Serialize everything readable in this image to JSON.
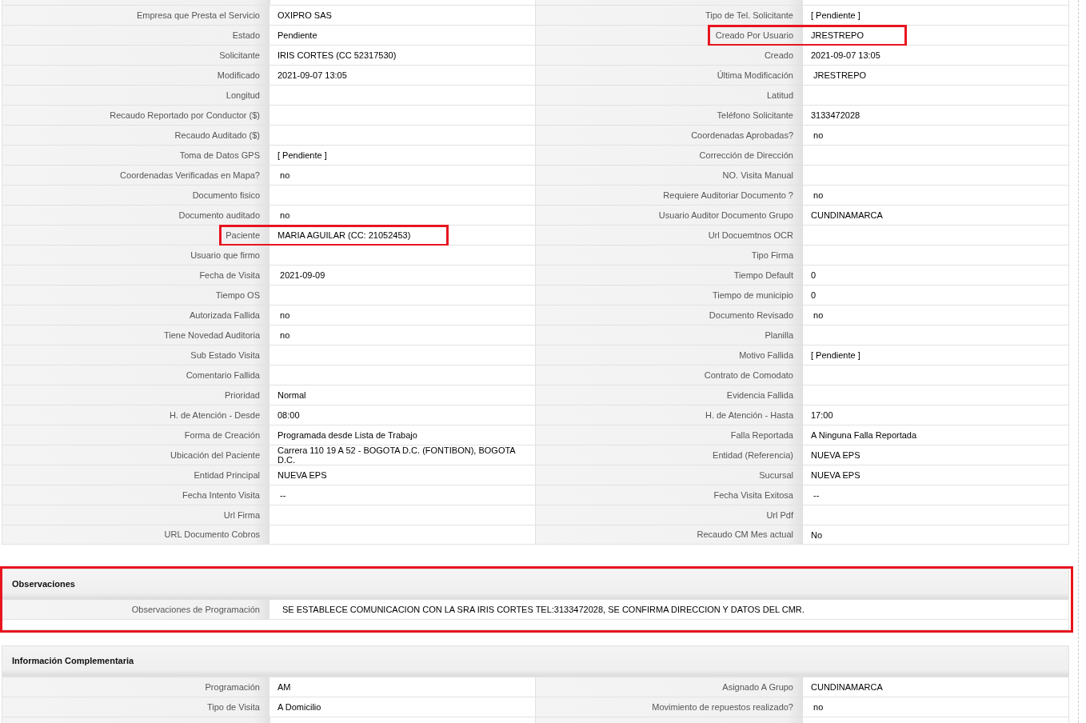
{
  "details": {
    "rows": [
      [
        {
          "label": "Empresa que Presta el Servicio",
          "value": "OXIPRO SAS",
          "highlighted": false
        },
        {
          "label": "Tipo de Tel. Solicitante",
          "value": "[ Pendiente ]",
          "highlighted": false
        }
      ],
      [
        {
          "label": "Estado",
          "value": "Pendiente",
          "highlighted": false
        },
        {
          "label": "Creado Por Usuario",
          "value": "JRESTREPO",
          "highlighted": true
        }
      ],
      [
        {
          "label": "Solicitante",
          "value": "IRIS CORTES (CC 52317530)",
          "highlighted": false
        },
        {
          "label": "Creado",
          "value": "2021-09-07 13:05",
          "highlighted": false
        }
      ],
      [
        {
          "label": "Modificado",
          "value": "2021-09-07 13:05",
          "highlighted": false
        },
        {
          "label": "Última Modificación",
          "value": " JRESTREPO",
          "highlighted": false
        }
      ],
      [
        {
          "label": "Longitud",
          "highlighted": false
        },
        {
          "label": "Latitud",
          "highlighted": false
        }
      ],
      [
        {
          "label": "Recaudo Reportado por Conductor ($)",
          "highlighted": false
        },
        {
          "label": "Teléfono Solicitante",
          "value": "3133472028",
          "highlighted": false
        }
      ],
      [
        {
          "label": "Recaudo Auditado ($)",
          "highlighted": false
        },
        {
          "label": "Coordenadas Aprobadas?",
          "value": " no",
          "highlighted": false
        }
      ],
      [
        {
          "label": "Toma de Datos GPS",
          "value": "[ Pendiente ]",
          "highlighted": false
        },
        {
          "label": "Corrección de Dirección",
          "highlighted": false
        }
      ],
      [
        {
          "label": "Coordenadas Verificadas en Mapa?",
          "value": " no",
          "highlighted": false
        },
        {
          "label": "NO. Visita Manual",
          "highlighted": false
        }
      ],
      [
        {
          "label": "Documento fisico",
          "highlighted": false
        },
        {
          "label": "Requiere Auditoriar Documento ?",
          "value": " no",
          "highlighted": false
        }
      ],
      [
        {
          "label": "Documento auditado",
          "value": " no",
          "highlighted": false
        },
        {
          "label": "Usuario Auditor Documento Grupo",
          "value": "CUNDINAMARCA",
          "highlighted": false
        }
      ],
      [
        {
          "label": "Paciente",
          "value": "MARIA AGUILAR (CC: 21052453)",
          "highlighted": true
        },
        {
          "label": "Url Docuemtnos OCR",
          "highlighted": false
        }
      ],
      [
        {
          "label": "Usuario que firmo",
          "highlighted": false
        },
        {
          "label": "Tipo Firma",
          "highlighted": false
        }
      ],
      [
        {
          "label": "Fecha de Visita",
          "value": " 2021-09-09",
          "highlighted": false
        },
        {
          "label": "Tiempo Default",
          "value": "0",
          "highlighted": false
        }
      ],
      [
        {
          "label": "Tiempo OS",
          "highlighted": false
        },
        {
          "label": "Tiempo de municipio",
          "value": "0",
          "highlighted": false
        }
      ],
      [
        {
          "label": "Autorizada Fallida",
          "value": " no",
          "highlighted": false
        },
        {
          "label": "Documento Revisado",
          "value": " no",
          "highlighted": false
        }
      ],
      [
        {
          "label": "Tiene Novedad Auditoria",
          "value": " no",
          "highlighted": false
        },
        {
          "label": "Planilla",
          "highlighted": false
        }
      ],
      [
        {
          "label": "Sub Estado Visita",
          "highlighted": false
        },
        {
          "label": "Motivo Fallida",
          "value": "[ Pendiente ]",
          "highlighted": false
        }
      ],
      [
        {
          "label": "Comentario Fallida",
          "highlighted": false
        },
        {
          "label": "Contrato de Comodato",
          "highlighted": false
        }
      ],
      [
        {
          "label": "Prioridad",
          "value": "Normal",
          "highlighted": false
        },
        {
          "label": "Evidencia Fallida",
          "highlighted": false
        }
      ],
      [
        {
          "label": "H. de Atención - Desde",
          "value": "08:00",
          "highlighted": false
        },
        {
          "label": "H. de Atención - Hasta",
          "value": "17:00",
          "highlighted": false
        }
      ],
      [
        {
          "label": "Forma de Creación",
          "value": "Programada desde Lista de Trabajo",
          "highlighted": false
        },
        {
          "label": "Falla Reportada",
          "value": "A Ninguna Falla Reportada",
          "highlighted": false
        }
      ],
      [
        {
          "label": "Ubicación del Paciente",
          "value": "Carrera 110 19 A 52 - BOGOTA D.C. (FONTIBON), BOGOTA D.C.",
          "highlighted": false
        },
        {
          "label": "Entidad (Referencia)",
          "value": "NUEVA EPS",
          "highlighted": false
        }
      ],
      [
        {
          "label": "Entidad Principal",
          "value": "NUEVA EPS",
          "highlighted": false
        },
        {
          "label": "Sucursal",
          "value": "NUEVA EPS",
          "highlighted": false
        }
      ],
      [
        {
          "label": "Fecha Intento Visita",
          "value": " --",
          "highlighted": false
        },
        {
          "label": "Fecha Visita Exitosa",
          "value": " --",
          "highlighted": false
        }
      ],
      [
        {
          "label": "Url Firma",
          "highlighted": false
        },
        {
          "label": "Url Pdf",
          "highlighted": false
        }
      ],
      [
        {
          "label": "URL Documento Cobros",
          "highlighted": false
        },
        {
          "label": "Recaudo CM Mes actual",
          "value": "No",
          "highlighted": false
        }
      ]
    ]
  },
  "observaciones": {
    "title": "Observaciones",
    "highlighted": true,
    "label": "Observaciones de Programación",
    "value": "SE ESTABLECE COMUNICACION CON LA SRA IRIS CORTES TEL:3133472028, SE CONFIRMA DIRECCION Y DATOS DEL CMR."
  },
  "informacion_complementaria": {
    "title": "Información Complementaria",
    "rows": [
      [
        {
          "label": "Programación",
          "value": "AM",
          "highlighted": false
        },
        {
          "label": "Asignado A Grupo",
          "value": "CUNDINAMARCA",
          "highlighted": false
        }
      ],
      [
        {
          "label": "Tipo de Visita",
          "value": "A Domicilio",
          "highlighted": false
        },
        {
          "label": "Movimiento de repuestos realizado?",
          "value": " no",
          "highlighted": false
        }
      ]
    ]
  }
}
